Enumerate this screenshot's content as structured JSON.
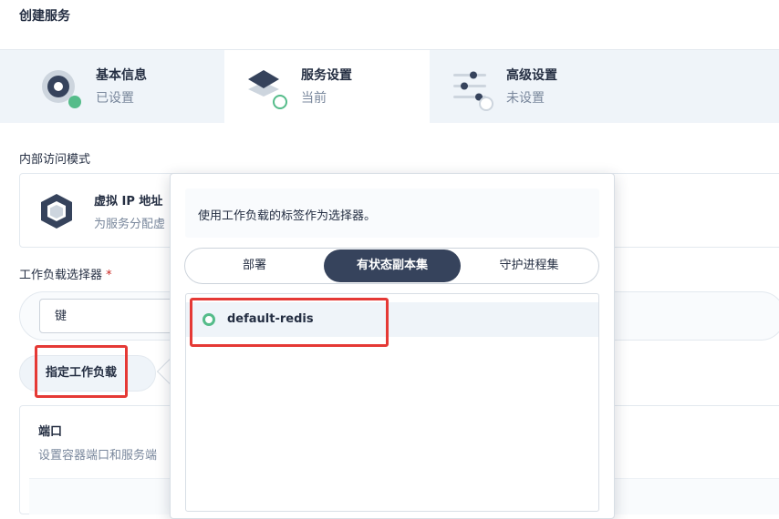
{
  "page": {
    "title": "创建服务"
  },
  "steps": [
    {
      "name": "基本信息",
      "status": "已设置",
      "icon": "target-icon",
      "state": "done"
    },
    {
      "name": "服务设置",
      "status": "当前",
      "icon": "layers-icon",
      "state": "current"
    },
    {
      "name": "高级设置",
      "status": "未设置",
      "icon": "sliders-icon",
      "state": "pending"
    }
  ],
  "access_mode": {
    "label": "内部访问模式",
    "option_title": "虚拟 IP 地址",
    "option_desc": "为服务分配虚"
  },
  "selector": {
    "label": "工作负载选择器",
    "required_mark": "*",
    "key_placeholder": "键",
    "assign_button": "指定工作负载"
  },
  "ports": {
    "title": "端口",
    "desc": "设置容器端口和服务端"
  },
  "popover": {
    "info": "使用工作负载的标签作为选择器。",
    "tabs": [
      "部署",
      "有状态副本集",
      "守护进程集"
    ],
    "selected_tab": 1,
    "items": [
      {
        "name": "default-redis",
        "status_color": "#55bc8a"
      }
    ]
  },
  "colors": {
    "accent_dark": "#36435c",
    "success": "#55bc8a",
    "highlight": "#e53935"
  }
}
